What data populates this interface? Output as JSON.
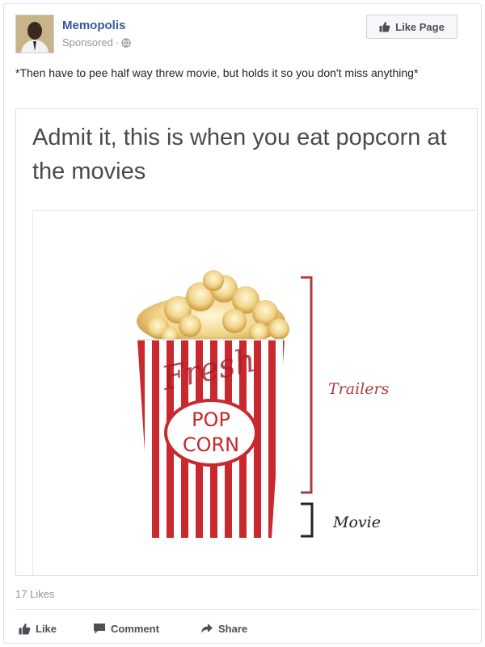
{
  "post": {
    "page_name": "Memopolis",
    "sponsored_label": "Sponsored",
    "sponsored_separator": "·",
    "like_page_label": "Like Page",
    "text": "*Then have to pee half way threw movie, but holds it so you don't miss anything*"
  },
  "meme": {
    "title": "Admit it, this is when you eat popcorn at the movies",
    "box_word_script": "Fresh",
    "box_word_1": "POP",
    "box_word_2": "CORN",
    "label_trailers": "Trailers",
    "label_movie": "Movie"
  },
  "footer": {
    "likes_count": "17 Likes",
    "like_label": "Like",
    "comment_label": "Comment",
    "share_label": "Share"
  },
  "icons": {
    "like_page": "thumbs-up-icon",
    "privacy": "globe-icon",
    "like": "thumbs-up-icon",
    "comment": "speech-bubble-icon",
    "share": "share-arrow-icon"
  },
  "colors": {
    "page_name": "#365899",
    "text": "#1d2129",
    "muted": "#90949c",
    "button_text": "#4b4f56",
    "stripe_red": "#c8282e",
    "trailers_text": "#b03a3a"
  }
}
